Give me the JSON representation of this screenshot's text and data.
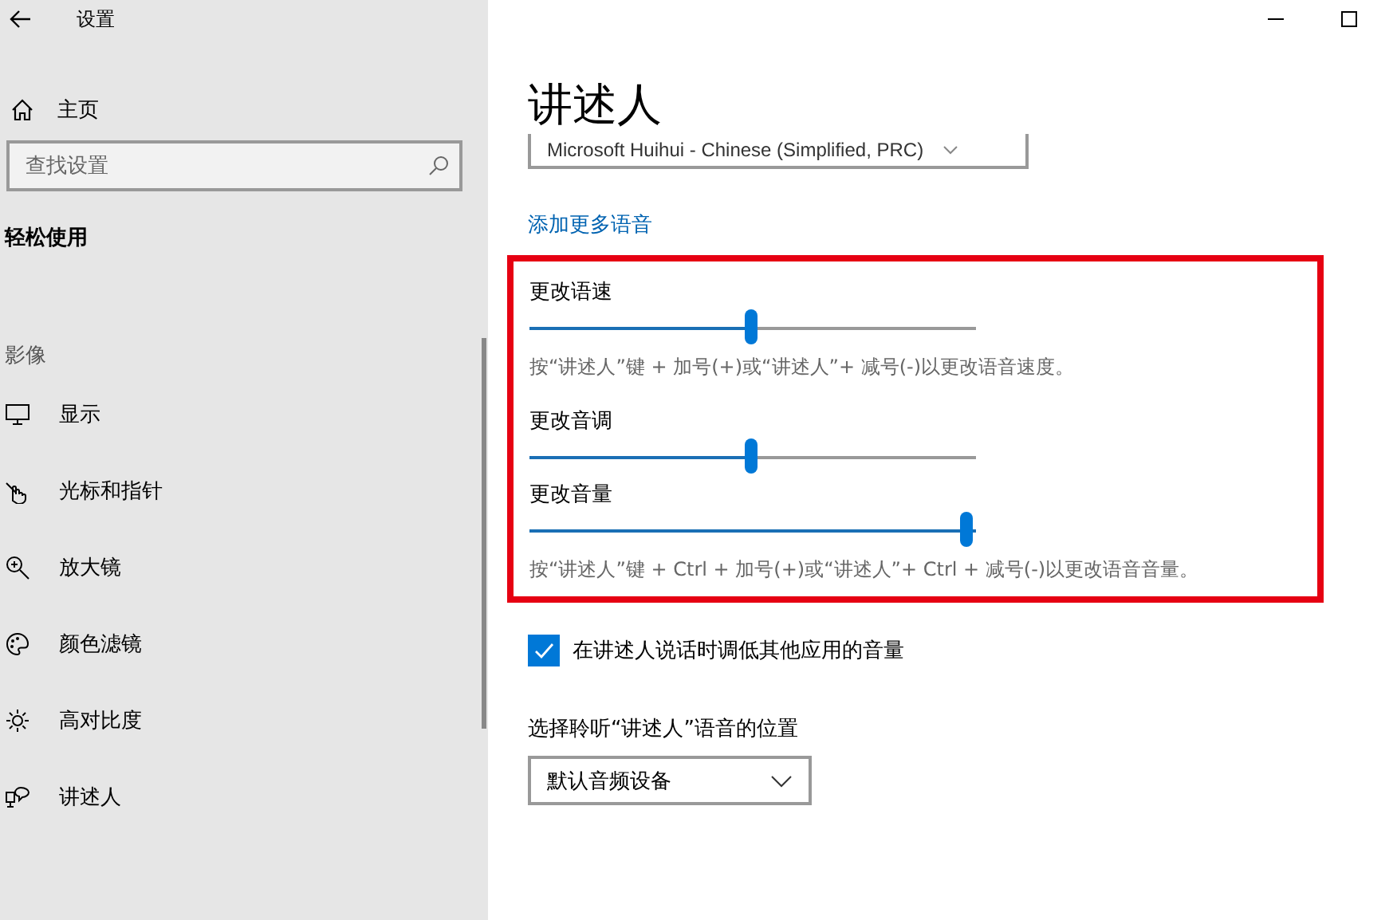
{
  "window": {
    "title": "设置"
  },
  "sidebar": {
    "home": "主页",
    "search": {
      "placeholder": "查找设置"
    },
    "category": "轻松使用",
    "section": "影像",
    "items": [
      {
        "kind": "display",
        "label": "显示"
      },
      {
        "kind": "cursor",
        "label": "光标和指针"
      },
      {
        "kind": "magnifier",
        "label": "放大镜"
      },
      {
        "kind": "palette",
        "label": "颜色滤镜"
      },
      {
        "kind": "contrast",
        "label": "高对比度"
      },
      {
        "kind": "narrator",
        "label": "讲述人"
      }
    ]
  },
  "page": {
    "title": "讲述人",
    "voice_dropdown": "Microsoft Huihui - Chinese (Simplified, PRC)",
    "add_voices_link": "添加更多语音",
    "sliders": [
      {
        "label": "更改语速",
        "level": 0.5,
        "hint": "按“讲述人”键 + 加号(+)或“讲述人”+ 减号(-)以更改语音速度。"
      },
      {
        "label": "更改音调",
        "level": 0.5
      },
      {
        "label": "更改音量",
        "level": 1,
        "hint": "按“讲述人”键 + Ctrl + 加号(+)或“讲述人”+ Ctrl + 减号(-)以更改语音音量。"
      }
    ],
    "lower_volume": {
      "label": "在讲述人说话时调低其他应用的音量",
      "checked": true
    },
    "output": {
      "label": "选择聆听“讲述人”语音的位置",
      "value": "默认音频设备"
    }
  }
}
